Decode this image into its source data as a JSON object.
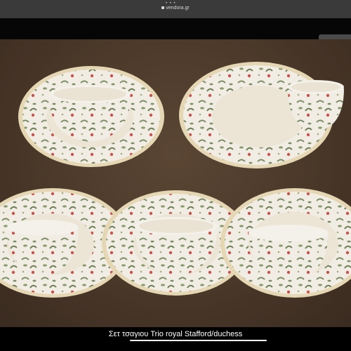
{
  "status": {
    "dots": "• • •",
    "url": "vendora.gr"
  },
  "photo": {
    "description_name": "royal-stafford-duchess-tea-set-photo",
    "colors": {
      "tablecloth": "#4a3829",
      "porcelain": "#f1ede5",
      "leaf": "#7c8e63",
      "flower": "#c5544d",
      "rim": "#e5d6b4"
    }
  },
  "caption": {
    "text": "Σετ τσαγιου Trio royal Stafford/duchess"
  }
}
